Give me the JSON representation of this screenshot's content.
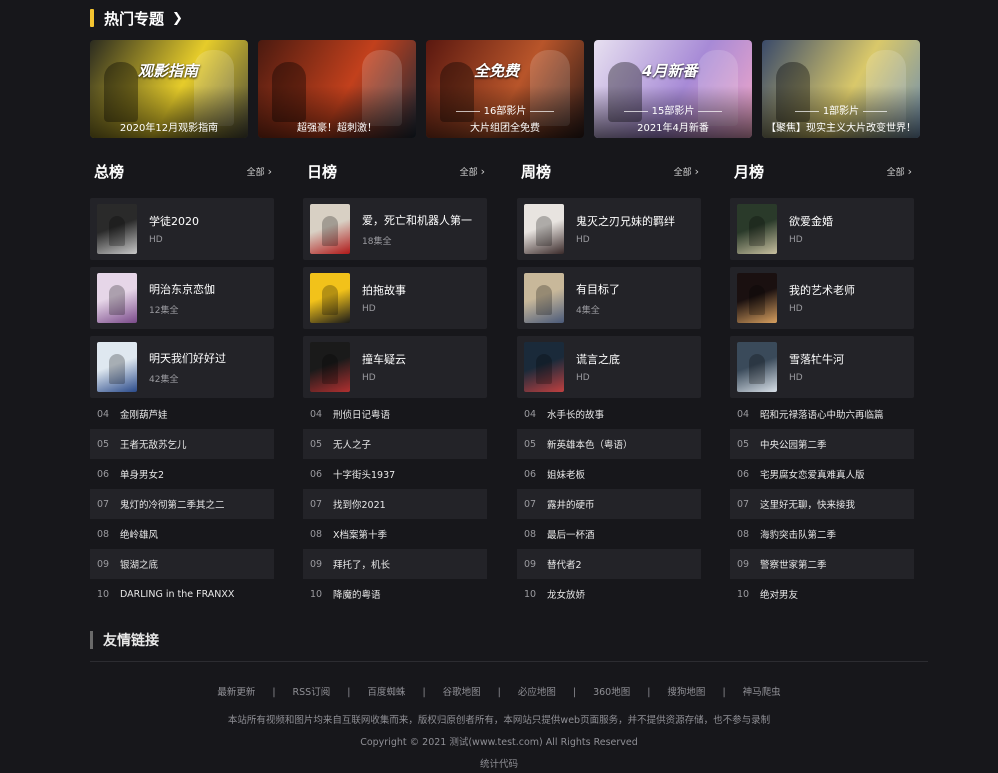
{
  "topics_section": {
    "title": "热门专题"
  },
  "topics": [
    {
      "name": "2020年12月观影指南",
      "count": "",
      "colors": [
        "#2b2b20",
        "#e6cc2a",
        "#4a4a3a"
      ],
      "banner": "观影指南"
    },
    {
      "name": "超强豪！超刺激！",
      "count": "",
      "colors": [
        "#4a1a10",
        "#c2401c",
        "#1e2a38"
      ],
      "banner": ""
    },
    {
      "name": "大片组团全免费",
      "count": "16部影片",
      "colors": [
        "#5a1810",
        "#b8552a",
        "#2a1a18"
      ],
      "banner": "全免费"
    },
    {
      "name": "2021年4月新番",
      "count": "15部影片",
      "colors": [
        "#e7e0f0",
        "#a78ad6",
        "#f4a8c8"
      ],
      "banner": "4月新番"
    },
    {
      "name": "【聚焦】现实主义大片改变世界！",
      "count": "1部影片",
      "colors": [
        "#3a4a6a",
        "#d9c86a",
        "#6e8eb0"
      ],
      "banner": ""
    }
  ],
  "rankings": [
    {
      "title": "总榜",
      "more": "全部",
      "top": [
        {
          "title": "学徒2020",
          "sub": "HD",
          "colors": [
            "#2a2a2a",
            "#c9c9c9"
          ]
        },
        {
          "title": "明治东京恋伽",
          "sub": "12集全",
          "colors": [
            "#e6d6e8",
            "#7a4a8a"
          ]
        },
        {
          "title": "明天我们好好过",
          "sub": "42集全",
          "colors": [
            "#dfe8f0",
            "#2a4a8a"
          ]
        }
      ],
      "rows": [
        {
          "num": "04",
          "title": "金刚葫芦娃"
        },
        {
          "num": "05",
          "title": "王者无敌苏乞儿"
        },
        {
          "num": "06",
          "title": "单身男女2"
        },
        {
          "num": "07",
          "title": "鬼灯的冷彻第二季其之二"
        },
        {
          "num": "08",
          "title": "绝岭雄风"
        },
        {
          "num": "09",
          "title": "银湖之底"
        },
        {
          "num": "10",
          "title": "DARLING in the FRANXX"
        }
      ]
    },
    {
      "title": "日榜",
      "more": "全部",
      "top": [
        {
          "title": "爱，死亡和机器人第一",
          "sub": "18集全",
          "colors": [
            "#d8d0c4",
            "#b01818"
          ]
        },
        {
          "title": "拍拖故事",
          "sub": "HD",
          "colors": [
            "#f2c21a",
            "#1a1a1a"
          ]
        },
        {
          "title": "撞车疑云",
          "sub": "HD",
          "colors": [
            "#1a1a1a",
            "#b03030"
          ]
        }
      ],
      "rows": [
        {
          "num": "04",
          "title": "刑侦日记粤语"
        },
        {
          "num": "05",
          "title": "无人之子"
        },
        {
          "num": "06",
          "title": "十字街头1937"
        },
        {
          "num": "07",
          "title": "找到你2021"
        },
        {
          "num": "08",
          "title": "X档案第十季"
        },
        {
          "num": "09",
          "title": "拜托了，机长"
        },
        {
          "num": "10",
          "title": "降魔的粤语"
        }
      ]
    },
    {
      "title": "周榜",
      "more": "全部",
      "top": [
        {
          "title": "鬼灭之刃兄妹的羁绊",
          "sub": "HD",
          "colors": [
            "#e8e4e0",
            "#3a2a2a"
          ]
        },
        {
          "title": "有目标了",
          "sub": "4集全",
          "colors": [
            "#c8b89a",
            "#4a5a7a"
          ]
        },
        {
          "title": "谎言之底",
          "sub": "HD",
          "colors": [
            "#1a2a3a",
            "#c04040"
          ]
        }
      ],
      "rows": [
        {
          "num": "04",
          "title": "水手长的故事"
        },
        {
          "num": "05",
          "title": "新英雄本色（粤语）"
        },
        {
          "num": "06",
          "title": "姐妹老板"
        },
        {
          "num": "07",
          "title": "露井的硬币"
        },
        {
          "num": "08",
          "title": "最后一杯酒"
        },
        {
          "num": "09",
          "title": "替代者2"
        },
        {
          "num": "10",
          "title": "龙女放娇"
        }
      ]
    },
    {
      "title": "月榜",
      "more": "全部",
      "top": [
        {
          "title": "欲爱金婚",
          "sub": "HD",
          "colors": [
            "#2a3a2a",
            "#c8c0a0"
          ]
        },
        {
          "title": "我的艺术老师",
          "sub": "HD",
          "colors": [
            "#1a1010",
            "#d8a060"
          ]
        },
        {
          "title": "雪落牤牛河",
          "sub": "HD",
          "colors": [
            "#3a4a5a",
            "#d8e0e8"
          ]
        }
      ],
      "rows": [
        {
          "num": "04",
          "title": "昭和元禄落语心中助六再临篇"
        },
        {
          "num": "05",
          "title": "中央公园第二季"
        },
        {
          "num": "06",
          "title": "宅男腐女恋爱真难真人版"
        },
        {
          "num": "07",
          "title": "这里好无聊，快来接我"
        },
        {
          "num": "08",
          "title": "海豹突击队第二季"
        },
        {
          "num": "09",
          "title": "警察世家第二季"
        },
        {
          "num": "10",
          "title": "绝对男友"
        }
      ]
    }
  ],
  "links_section": {
    "title": "友情链接"
  },
  "footer": {
    "nav": [
      "最新更新",
      "RSS订阅",
      "百度蜘蛛",
      "谷歌地图",
      "必应地图",
      "360地图",
      "搜狗地图",
      "神马爬虫"
    ],
    "separator": "|",
    "disclaimer": "本站所有视频和图片均来自互联网收集而来，版权归原创者所有，本网站只提供web页面服务，并不提供资源存储，也不参与录制",
    "copyright": "Copyright © 2021 测试(www.test.com) All Rights Reserved",
    "stats": "统计代码"
  }
}
